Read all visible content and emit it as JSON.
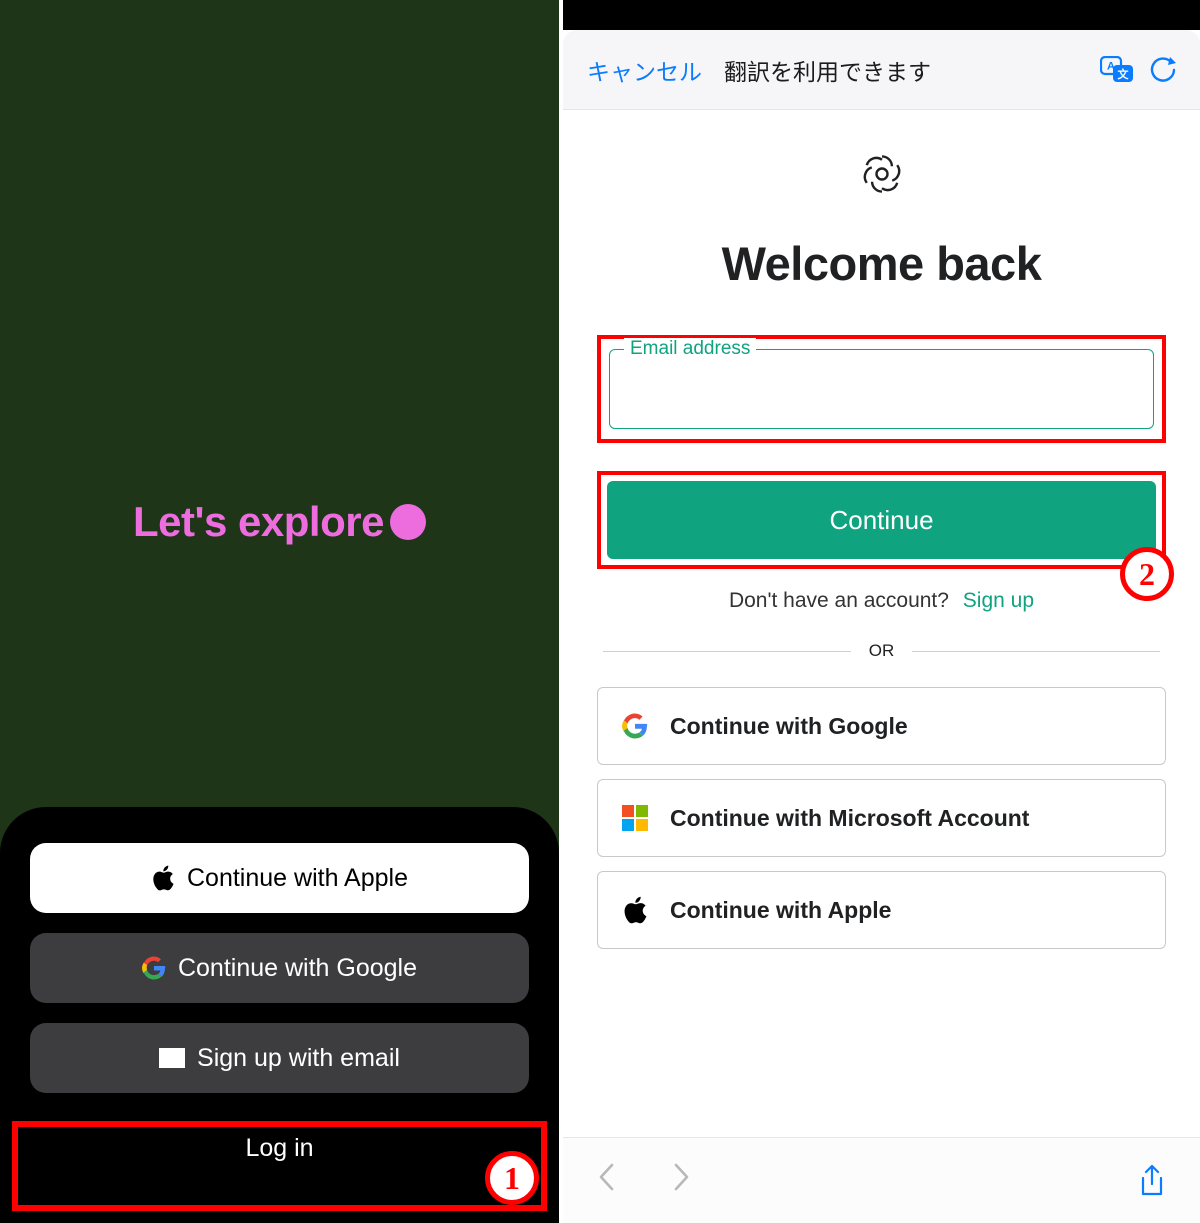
{
  "left": {
    "hero_text": "Let's explore",
    "buttons": {
      "apple": "Continue with Apple",
      "google": "Continue with Google",
      "email": "Sign up with email",
      "login": "Log in"
    },
    "annotation_number": "1"
  },
  "right": {
    "toolbar": {
      "cancel": "キャンセル",
      "message": "翻訳を利用できます"
    },
    "welcome": "Welcome back",
    "email_label": "Email address",
    "continue": "Continue",
    "no_account": "Don't have an account?",
    "signup": "Sign up",
    "or": "OR",
    "oauth": {
      "google": "Continue with Google",
      "microsoft": "Continue with Microsoft Account",
      "apple": "Continue with Apple"
    },
    "annotation_number": "2"
  }
}
